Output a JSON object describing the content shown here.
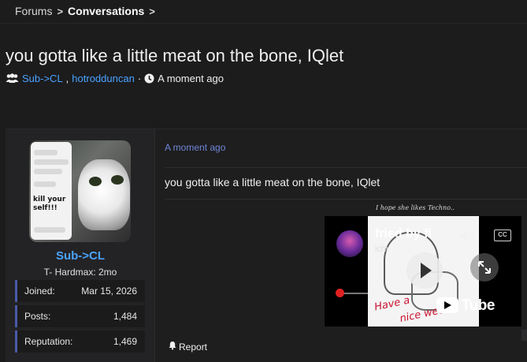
{
  "breadcrumb": {
    "forums": "Forums",
    "separator": ">",
    "conversations": "Conversations"
  },
  "thread": {
    "title": "you gotta like a little meat on the bone, IQlet",
    "participants_icon": "users-icon",
    "participant_1": "Sub->CL",
    "comma": ",",
    "participant_2": "hotrodduncan",
    "bullet": "·",
    "clock_icon": "clock-icon",
    "time": "A moment ago"
  },
  "user": {
    "avatar_text": "kill your self!!!",
    "name": "Sub->CL",
    "title": "T- Hardmax: 2mo",
    "stats": [
      {
        "label": "Joined:",
        "value": "Mar 15, 2026"
      },
      {
        "label": "Posts:",
        "value": "1,484"
      },
      {
        "label": "Reputation:",
        "value": "1,469"
      }
    ]
  },
  "post": {
    "time": "A moment ago",
    "message": "you gotta like a little meat on the bone, IQlet",
    "report_icon": "bell-icon",
    "report_label": "Report"
  },
  "signature": {
    "caption": "I hope she likes Techno..",
    "video_title": "fried by fi",
    "video_channel": "ichi",
    "cc_label": "CC",
    "brand": "Tube",
    "overlay_text_1": "Have a",
    "overlay_text_2": "nice week!"
  },
  "colors": {
    "link": "#4aa3ff",
    "time_link": "#6f86d6",
    "stat_accent": "#4a5aa8",
    "background": "#1c1c1d"
  }
}
